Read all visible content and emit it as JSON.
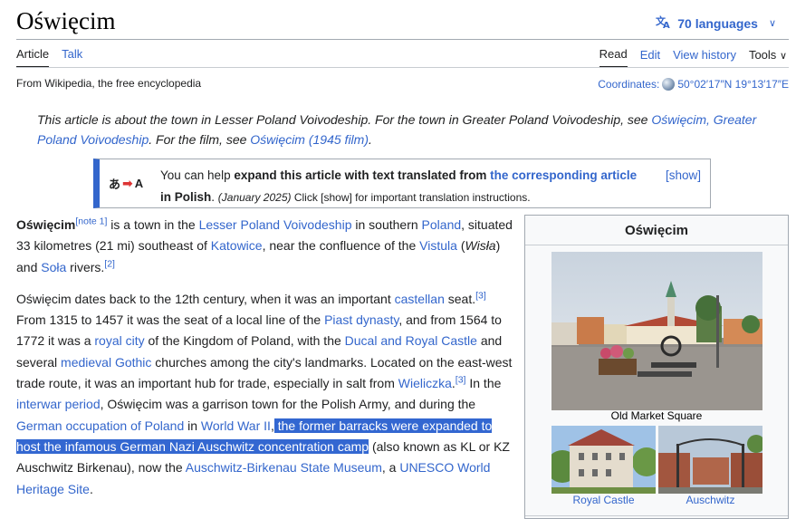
{
  "header": {
    "title": "Oświęcim",
    "languages": "70 languages"
  },
  "tabs": {
    "left": [
      "Article",
      "Talk"
    ],
    "right": [
      "Read",
      "Edit",
      "View history",
      "Tools"
    ]
  },
  "tagline": "From Wikipedia, the free encyclopedia",
  "coordinates": {
    "label": "Coordinates:",
    "value": "50°02′17″N 19°13′17″E"
  },
  "hatnote": {
    "t1": "This article is about the town in Lesser Poland Voivodeship. For the town in Greater Poland Voivodeship, see ",
    "l1": "Oświęcim, Greater Poland Voivodeship",
    "t2": ". For the film, see ",
    "l2": "Oświęcim (1945 film)",
    "t3": "."
  },
  "notice": {
    "icon_text_left": "あ",
    "icon_text_right": "A",
    "t1": "You can help ",
    "b1": "expand this article with text translated from ",
    "l1": "the corresponding article",
    "b2": " in Polish",
    "t2": ". ",
    "date": "(January 2025)",
    "t3": " Click [show] for important translation instructions.",
    "show": "[show]"
  },
  "para1": {
    "bold": "Oświęcim",
    "note": "[note 1]",
    "t1": " is a town in the ",
    "l1": "Lesser Poland Voivodeship",
    "t2": " in southern ",
    "l2": "Poland",
    "t3": ", situated 33 kilometres (21 mi) southeast of ",
    "l3": "Katowice",
    "t4": ", near the confluence of the ",
    "l4": "Vistula",
    "t5": " (",
    "i1": "Wisła",
    "t6": ") and ",
    "l5": "Soła",
    "t7": " rivers.",
    "ref": "[2]"
  },
  "para2": {
    "t1": "Oświęcim dates back to the 12th century, when it was an important ",
    "l1": "castellan",
    "t2": " seat.",
    "ref1": "[3]",
    "t3": " From 1315 to 1457 it was the seat of a local line of the ",
    "l2": "Piast dynasty",
    "t4": ", and from 1564 to 1772 it was a ",
    "l3": "royal city",
    "t5": " of the Kingdom of Poland, with the ",
    "l4": "Ducal and Royal Castle",
    "t6": " and several ",
    "l5": "medieval",
    "t7": " ",
    "l6": "Gothic",
    "t8": " churches among the city's landmarks. Located on the east-west trade route, it was an important hub for trade, especially in salt from ",
    "l7": "Wieliczka",
    "t9": ".",
    "ref2": "[3]",
    "t10": " In the ",
    "l8": "interwar period",
    "t11": ", Oświęcim was a garrison town for the Polish Army, and during the ",
    "l9": "German occupation of Poland",
    "t12": " in ",
    "l10": "World War II",
    "t13": ",",
    "hl": " the former barracks were expanded to host the infamous German Nazi Auschwitz concentration camp",
    "t14": " (also known as KL or KZ Auschwitz Birkenau), now the ",
    "l11": "Auschwitz-Birkenau State Museum",
    "t15": ", a ",
    "l12": "UNESCO World Heritage Site",
    "t16": "."
  },
  "infobox": {
    "title": "Oświęcim",
    "main_caption": "Old Market Square",
    "caption_left": "Royal Castle",
    "caption_right": "Auschwitz"
  }
}
